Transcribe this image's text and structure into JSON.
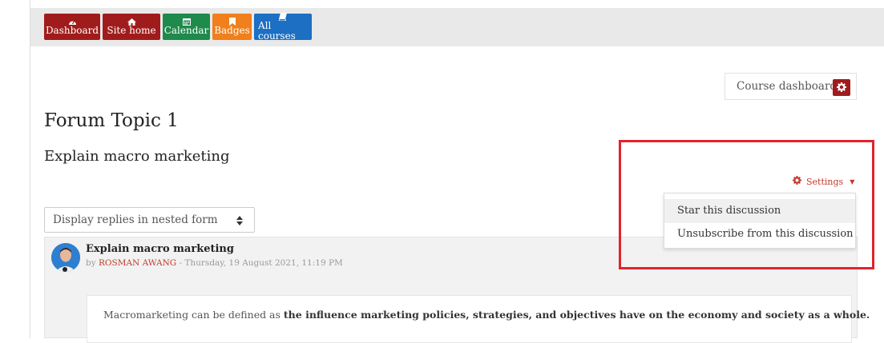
{
  "nav": {
    "buttons": [
      {
        "label": "Dashboard",
        "icon": "dashboard-icon",
        "color": "#a01c1c"
      },
      {
        "label": "Site home",
        "icon": "home-icon",
        "color": "#a01c1c"
      },
      {
        "label": "Calendar",
        "icon": "calendar-icon",
        "color": "#1e8a4b"
      },
      {
        "label": "Badges",
        "icon": "bookmark-icon",
        "color": "#f07f1c"
      },
      {
        "label": "All courses",
        "icon": "book-icon",
        "color": "#1c6fc2"
      }
    ]
  },
  "course_dashboard": {
    "label": "Course dashboard",
    "icon": "gear-icon",
    "color": "#a01c1c"
  },
  "page": {
    "title": "Forum Topic 1",
    "discussion_title": "Explain macro marketing"
  },
  "settings": {
    "label": "Settings",
    "icon": "gear-icon",
    "color": "#c0392b",
    "menu": [
      {
        "label": "Star this discussion"
      },
      {
        "label": "Unsubscribe from this discussion"
      }
    ]
  },
  "display_mode": {
    "selected": "Display replies in nested form"
  },
  "post": {
    "subject": "Explain macro marketing",
    "by": "by",
    "author": "ROSMAN AWANG",
    "date": " - Thursday, 19 August 2021, 11:19 PM",
    "body_prefix": "Macromarketing can be defined as ",
    "body_bold": "the influence marketing policies, strategies, and objectives have on the economy and society as a whole."
  },
  "highlight_color": "#e2232b"
}
